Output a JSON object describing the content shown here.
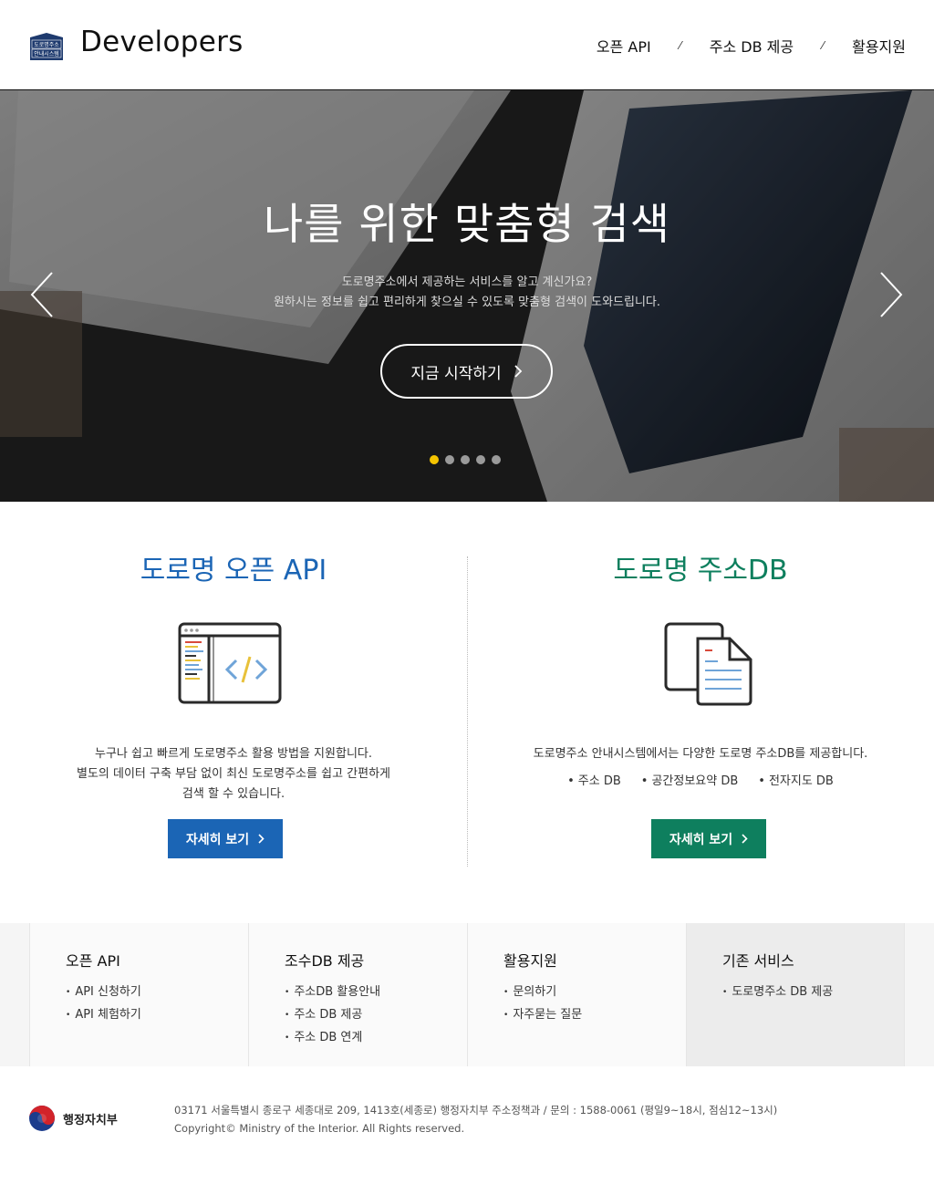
{
  "header": {
    "logo_badge_line1": "도로명주소",
    "logo_badge_line2": "안내시스템",
    "logo_text": "Developers",
    "nav": [
      "오픈 API",
      "주소 DB 제공",
      "활용지원"
    ],
    "nav_separator": "⁄"
  },
  "hero": {
    "title": "나를 위한 맞춤형 검색",
    "subtitle_line1": "도로명주소에서 제공하는 서비스를 알고 계신가요?",
    "subtitle_line2": "원하시는 정보를 쉽고 편리하게 찾으실 수 있도록 맞춤형 검색이 도와드립니다.",
    "button_label": "지금 시작하기",
    "active_slide": 1,
    "slide_count": 5,
    "active_dot_color": "#f5c400"
  },
  "features": {
    "api": {
      "title": "도로명 오픈 API",
      "desc_line1": "누구나 쉽고 빠르게 도로명주소 활용 방법을 지원합니다.",
      "desc_line2": "별도의 데이터 구축 부담 없이 최신 도로명주소를 쉽고 간편하게",
      "desc_line3": "검색 할 수 있습니다.",
      "button_label": "자세히 보기",
      "color": "#1b65b5"
    },
    "db": {
      "title": "도로명 주소DB",
      "desc_line1": "도로명주소 안내시스템에서는 다양한 도로명 주소DB를 제공합니다.",
      "bullets": [
        "주소 DB",
        "공간정보요약 DB",
        "전자지도 DB"
      ],
      "button_label": "자세히 보기",
      "color": "#0e7f5e"
    }
  },
  "sitemap": [
    {
      "title": "오픈 API",
      "items": [
        "API  신청하기",
        "API  체험하기"
      ]
    },
    {
      "title": "조수DB 제공",
      "items": [
        "주소DB 활용안내",
        "주소 DB 제공",
        "주소 DB 연계"
      ]
    },
    {
      "title": "활용지원",
      "items": [
        "문의하기",
        "자주묻는 질문"
      ]
    },
    {
      "title": "기존 서비스",
      "items": [
        "도로명주소 DB 제공"
      ]
    }
  ],
  "footer": {
    "ministry_name": "행정자치부",
    "address": "03171 서울특별시 종로구 세종대로 209, 1413호(세종로) 행정자치부 주소정책과 / 문의 : 1588-0061 (평일9~18시, 점심12~13시)",
    "copyright": "Copyright© Ministry of the Interior. All Rights reserved."
  }
}
